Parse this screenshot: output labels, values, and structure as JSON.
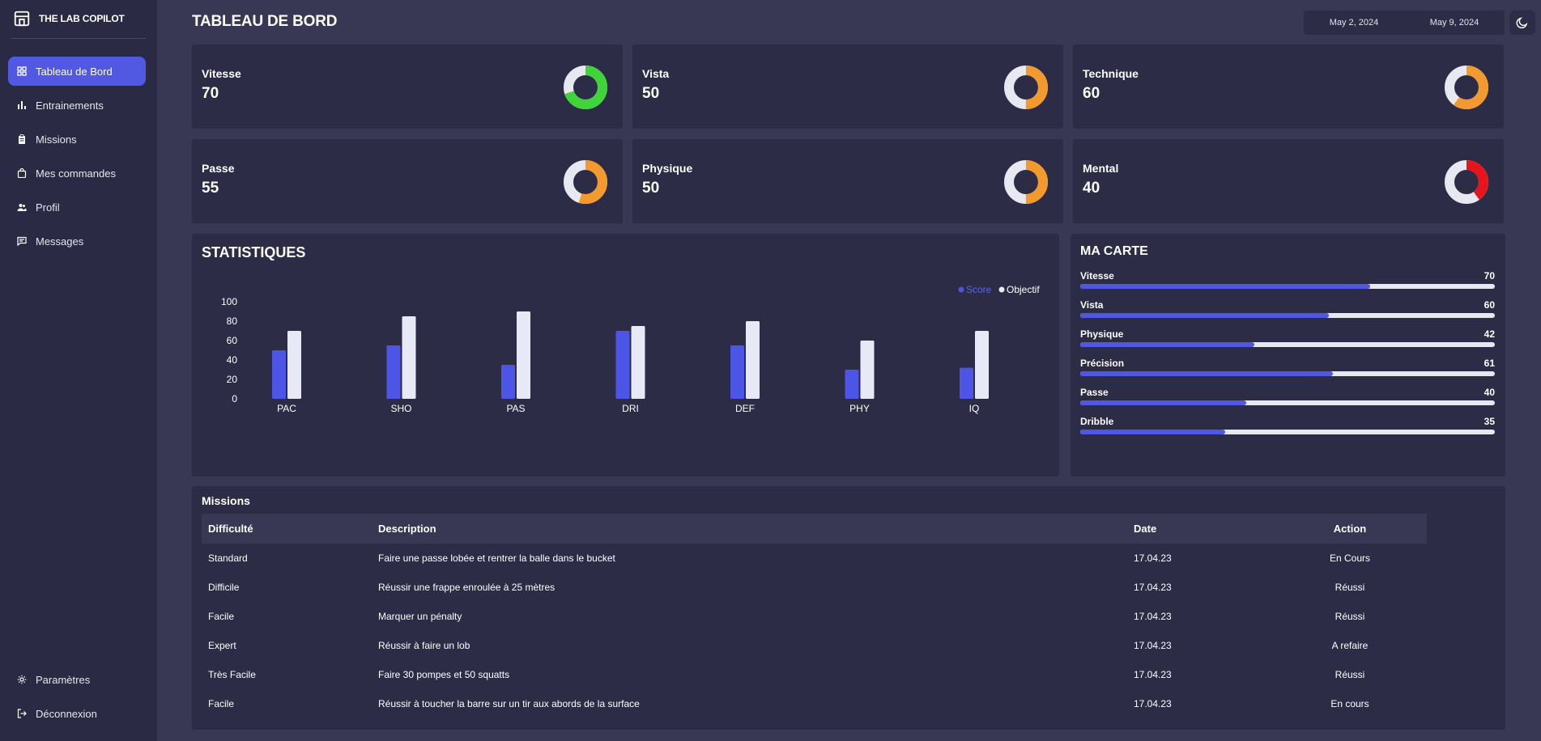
{
  "app": {
    "name": "THE LAB COPILOT"
  },
  "sidebar": {
    "items": [
      {
        "label": "Tableau de Bord",
        "icon": "grid-icon",
        "active": true
      },
      {
        "label": "Entrainements",
        "icon": "bar-chart-icon"
      },
      {
        "label": "Missions",
        "icon": "clipboard-icon"
      },
      {
        "label": "Mes commandes",
        "icon": "shopping-bag-icon"
      },
      {
        "label": "Profil",
        "icon": "users-icon"
      },
      {
        "label": "Messages",
        "icon": "message-icon"
      }
    ],
    "bottom": [
      {
        "label": "Paramètres",
        "icon": "gear-icon"
      },
      {
        "label": "Déconnexion",
        "icon": "logout-icon"
      }
    ]
  },
  "header": {
    "title": "TABLEAU DE BORD",
    "date_start": "May 2, 2024",
    "date_end": "May 9, 2024"
  },
  "stats": [
    {
      "label": "Vitesse",
      "value": "70",
      "fraction": 0.7,
      "color": "#3fd43a"
    },
    {
      "label": "Vista",
      "value": "50",
      "fraction": 0.5,
      "color": "#f29a2e"
    },
    {
      "label": "Technique",
      "value": "60",
      "fraction": 0.6,
      "color": "#f29a2e"
    },
    {
      "label": "Passe",
      "value": "55",
      "fraction": 0.55,
      "color": "#f29a2e"
    },
    {
      "label": "Physique",
      "value": "50",
      "fraction": 0.5,
      "color": "#f29a2e"
    },
    {
      "label": "Mental",
      "value": "40",
      "fraction": 0.4,
      "color": "#e8141b"
    }
  ],
  "statistics": {
    "title": "STATISTIQUES",
    "legend": [
      "Score",
      "Objectif"
    ]
  },
  "chart_data": {
    "type": "bar",
    "categories": [
      "PAC",
      "SHO",
      "PAS",
      "DRI",
      "DEF",
      "PHY",
      "IQ"
    ],
    "series": [
      {
        "name": "Score",
        "values": [
          50,
          55,
          35,
          70,
          55,
          30,
          32
        ],
        "color": "#4c55e6"
      },
      {
        "name": "Objectif",
        "values": [
          70,
          85,
          90,
          75,
          80,
          60,
          70
        ],
        "color": "#e8e9f6"
      }
    ],
    "yticks": [
      0,
      20,
      40,
      60,
      80,
      100
    ],
    "ylim": [
      0,
      100
    ],
    "legend_position": "top-right",
    "grid": false
  },
  "ma_carte": {
    "title": "MA CARTE",
    "rows": [
      {
        "label": "Vitesse",
        "value": "70",
        "fraction": 0.7
      },
      {
        "label": "Vista",
        "value": "60",
        "fraction": 0.6
      },
      {
        "label": "Physique",
        "value": "42",
        "fraction": 0.42
      },
      {
        "label": "Précision",
        "value": "61",
        "fraction": 0.61
      },
      {
        "label": "Passe",
        "value": "40",
        "fraction": 0.4
      },
      {
        "label": "Dribble",
        "value": "35",
        "fraction": 0.35
      }
    ]
  },
  "missions": {
    "title": "Missions",
    "columns": [
      "Difficulté",
      "Description",
      "Date",
      "Action"
    ],
    "rows": [
      [
        "Standard",
        "Faire une passe lobée et rentrer la balle dans le bucket",
        "17.04.23",
        "En Cours"
      ],
      [
        "Difficile",
        "Réussir une frappe enroulée à 25 mètres",
        "17.04.23",
        "Réussi"
      ],
      [
        "Facile",
        "Marquer un pénalty",
        "17.04.23",
        "Réussi"
      ],
      [
        "Expert",
        "Réussir à faire un lob",
        "17.04.23",
        "A refaire"
      ],
      [
        "Très Facile",
        "Faire 30 pompes et 50 squatts",
        "17.04.23",
        "Réussi"
      ],
      [
        "Facile",
        "Réussir à toucher la barre sur un tir aux abords de la surface",
        "17.04.23",
        "En cours"
      ]
    ]
  }
}
